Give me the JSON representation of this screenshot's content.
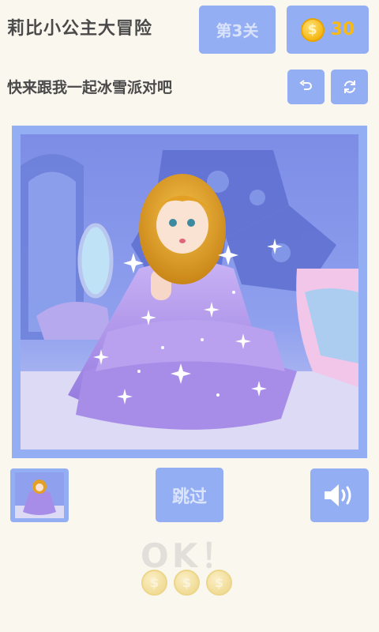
{
  "header": {
    "title": "莉比小公主大冒险",
    "level_label": "第3关",
    "coin_count": "30",
    "coin_symbol": "$"
  },
  "hint": {
    "text": "快来跟我一起冰雪派对吧"
  },
  "toolbar": {
    "undo_icon": "undo-icon",
    "refresh_icon": "refresh-icon"
  },
  "footer": {
    "skip_label": "跳过",
    "ok_text": "OK！",
    "reward_coins": [
      "$",
      "$",
      "$"
    ],
    "sound_icon": "speaker-icon"
  },
  "colors": {
    "accent": "#94aef3",
    "background": "#faf7ee",
    "coin": "#f5b816",
    "title_text": "#4a4a4a"
  }
}
